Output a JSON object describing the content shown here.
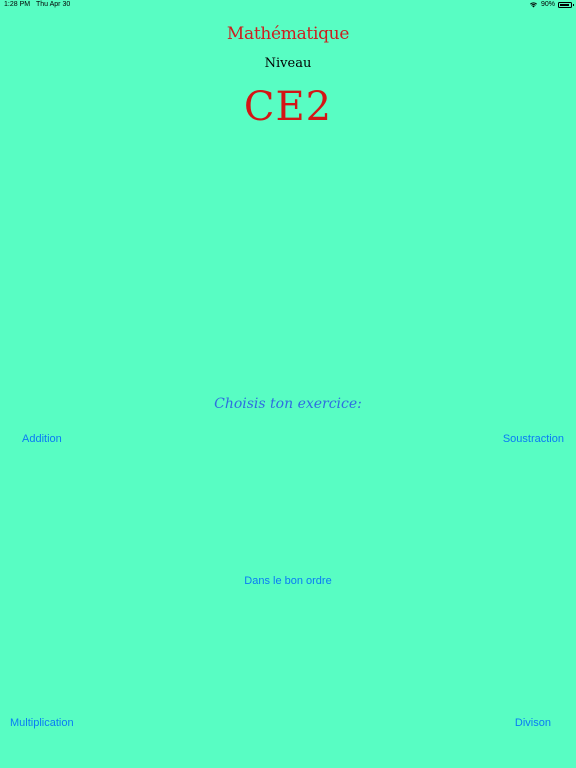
{
  "status_bar": {
    "time": "1:28 PM",
    "date": "Thu Apr 30",
    "battery": "90%",
    "battery_level": 0.9,
    "wifi_icon": "wifi-icon",
    "battery_icon": "battery-icon"
  },
  "header": {
    "title": "Mathématique",
    "subtitle": "Niveau",
    "level": "CE2"
  },
  "main": {
    "prompt": "Choisis ton exercice:",
    "buttons": {
      "addition": "Addition",
      "soustraction": "Soustraction",
      "ordre": "Dans le bon ordre",
      "multiplication": "Multiplication",
      "division": "Divison"
    }
  },
  "colors": {
    "background": "#58fdc3",
    "title_red": "#cc1f1f",
    "link_blue": "#0a7af5",
    "prompt_blue": "#2f6de0"
  }
}
